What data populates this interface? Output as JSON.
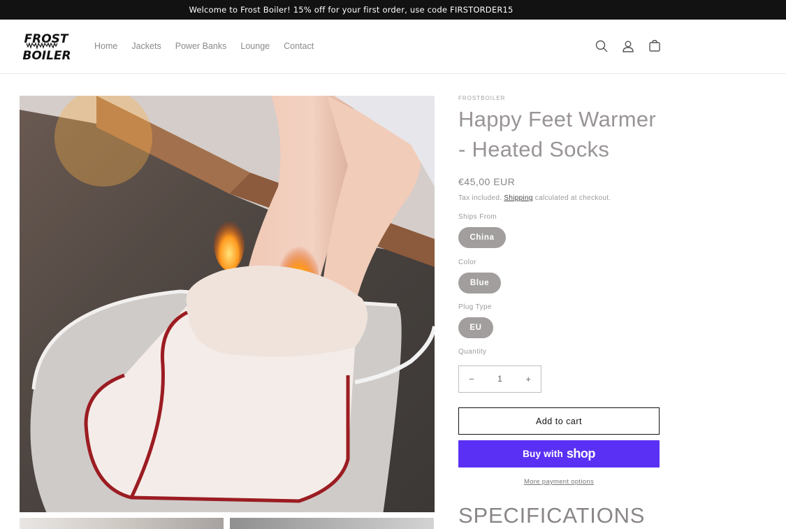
{
  "announcement": "Welcome to Frost Boiler! 15% off for your first order, use code FIRSTORDER15",
  "logo": {
    "line1": "FROST",
    "line2": "BOILER"
  },
  "nav": [
    "Home",
    "Jackets",
    "Power Banks",
    "Lounge",
    "Contact"
  ],
  "header_icons": [
    "search-icon",
    "account-icon",
    "cart-icon"
  ],
  "product": {
    "vendor": "FROSTBOILER",
    "title": "Happy Feet Warmer - Heated Socks",
    "price": "€45,00 EUR",
    "tax_prefix": "Tax included.",
    "tax_link": "Shipping",
    "tax_suffix": "calculated at checkout.",
    "options": [
      {
        "label": "Ships From",
        "value": "China"
      },
      {
        "label": "Color",
        "value": "Blue"
      },
      {
        "label": "Plug Type",
        "value": "EU"
      }
    ],
    "quantity_label": "Quantity",
    "quantity_value": "1",
    "minus": "−",
    "plus": "+",
    "add_to_cart": "Add to cart",
    "buy_with": "Buy with",
    "shop": "shop",
    "more_payment": "More payment options",
    "specs_heading": "SPECIFICATIONS"
  },
  "colors": {
    "accent_shop": "#5a31f4",
    "pill_bg": "#a29e9e",
    "announcement_bg": "#121212"
  }
}
